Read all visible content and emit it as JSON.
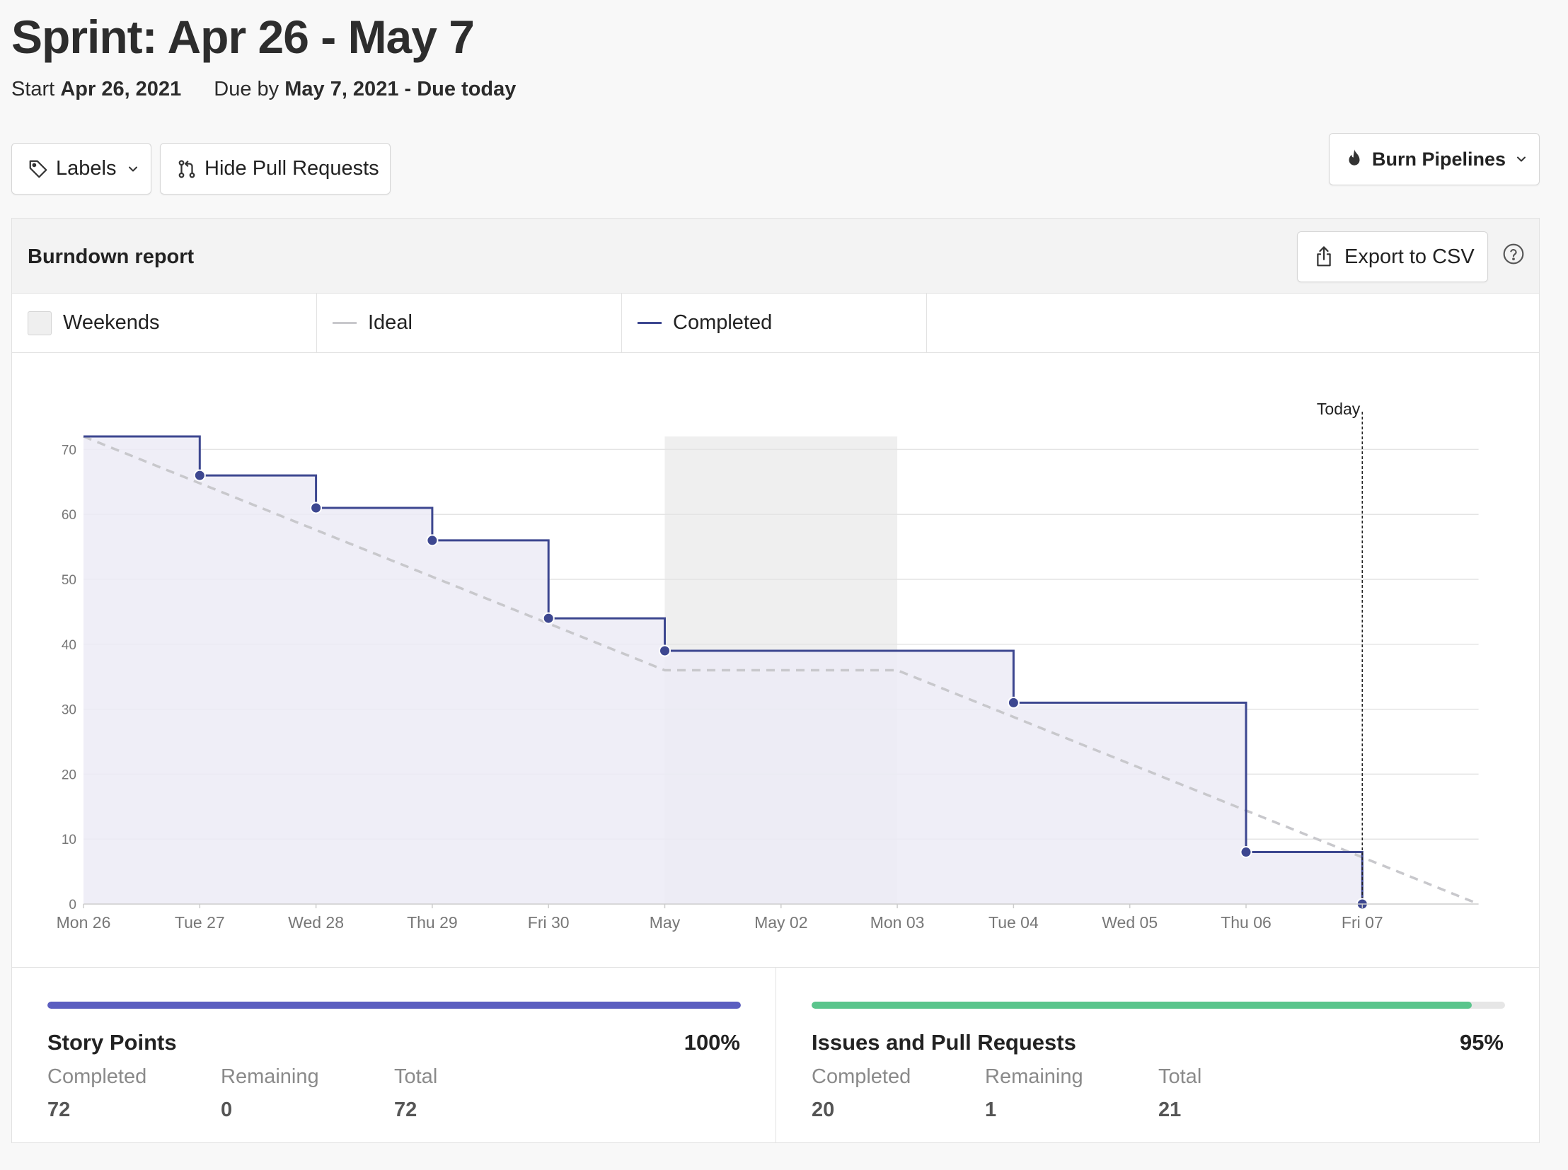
{
  "sprint": {
    "title": "Sprint: Apr 26 - May 7",
    "start_label": "Start",
    "start_date": "Apr 26, 2021",
    "due_label": "Due by",
    "due_date": "May 7, 2021 - Due today"
  },
  "toolbar": {
    "labels_button": "Labels",
    "hide_pr_button": "Hide Pull Requests",
    "burn_pipelines_button": "Burn Pipelines"
  },
  "report": {
    "title": "Burndown report",
    "export_button": "Export to CSV",
    "legend": [
      {
        "label": "Weekends"
      },
      {
        "label": "Ideal"
      },
      {
        "label": "Completed"
      }
    ]
  },
  "colors": {
    "completed": "#3d4790",
    "completed_fill": "#ecebf6",
    "ideal": "#c8c8cc",
    "weekend": "#efefef",
    "story_points_bar": "#5b5ec0",
    "issues_bar": "#5ac58c"
  },
  "chart_data": {
    "type": "line",
    "today_label": "Today",
    "x_labels": [
      "Mon 26",
      "Tue 27",
      "Wed 28",
      "Thu 29",
      "Fri 30",
      "May",
      "May 02",
      "Mon 03",
      "Tue 04",
      "Wed 05",
      "Thu 06",
      "Fri 07"
    ],
    "ylim": [
      0,
      72
    ],
    "yticks": [
      0,
      10,
      20,
      30,
      40,
      50,
      60,
      70
    ],
    "weekend_range": [
      5,
      7
    ],
    "today_index": 11,
    "series": [
      {
        "name": "Ideal",
        "style": "dashed",
        "points": [
          [
            0,
            72
          ],
          [
            5,
            36
          ],
          [
            7,
            36
          ],
          [
            12,
            0
          ]
        ]
      },
      {
        "name": "Completed",
        "style": "step",
        "points": [
          [
            0,
            72
          ],
          [
            1,
            66
          ],
          [
            2,
            61
          ],
          [
            3,
            56
          ],
          [
            4,
            44
          ],
          [
            5,
            39
          ],
          [
            8,
            31
          ],
          [
            10,
            8
          ],
          [
            11,
            0
          ]
        ]
      }
    ]
  },
  "stats": [
    {
      "title": "Story Points",
      "percent_label": "100%",
      "progress": 1.0,
      "columns": [
        {
          "label": "Completed",
          "value": "72"
        },
        {
          "label": "Remaining",
          "value": "0"
        },
        {
          "label": "Total",
          "value": "72"
        }
      ]
    },
    {
      "title": "Issues and Pull Requests",
      "percent_label": "95%",
      "progress": 0.952,
      "columns": [
        {
          "label": "Completed",
          "value": "20"
        },
        {
          "label": "Remaining",
          "value": "1"
        },
        {
          "label": "Total",
          "value": "21"
        }
      ]
    }
  ]
}
